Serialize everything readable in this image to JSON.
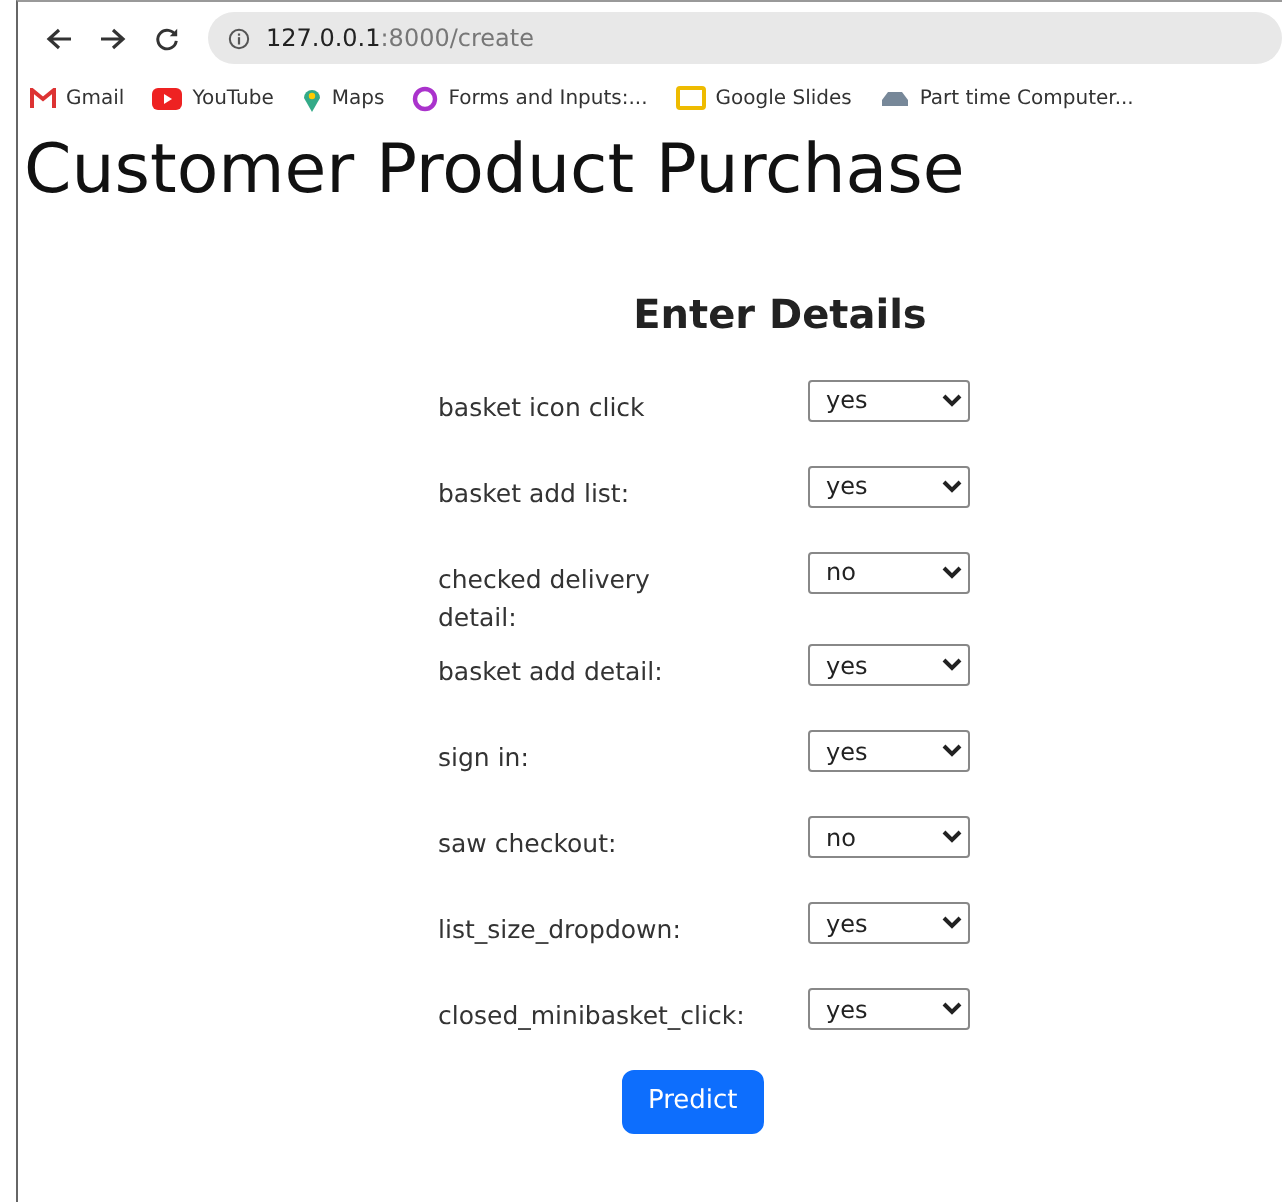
{
  "browser": {
    "address_host": "127.0.0.1",
    "address_path": ":8000/create",
    "bookmarks": [
      {
        "kind": "gmail",
        "label": "Gmail"
      },
      {
        "kind": "youtube",
        "label": "YouTube"
      },
      {
        "kind": "maps",
        "label": "Maps"
      },
      {
        "kind": "forms",
        "label": "Forms and Inputs:..."
      },
      {
        "kind": "slides",
        "label": "Google Slides"
      },
      {
        "kind": "car",
        "label": "Part time Computer..."
      }
    ]
  },
  "page": {
    "title": "Customer Product Purchase",
    "form_title": "Enter Details",
    "fields": [
      {
        "label": "basket icon click",
        "value": "yes"
      },
      {
        "label": "basket add list:",
        "value": "yes"
      },
      {
        "label": "checked delivery detail:",
        "value": "no"
      },
      {
        "label": "basket add detail:",
        "value": "yes"
      },
      {
        "label": "sign in:",
        "value": "yes"
      },
      {
        "label": "saw checkout:",
        "value": "no"
      },
      {
        "label": "list_size_dropdown:",
        "value": "yes"
      },
      {
        "label": "closed_minibasket_click:",
        "value": "yes"
      }
    ],
    "submit": "Predict"
  }
}
